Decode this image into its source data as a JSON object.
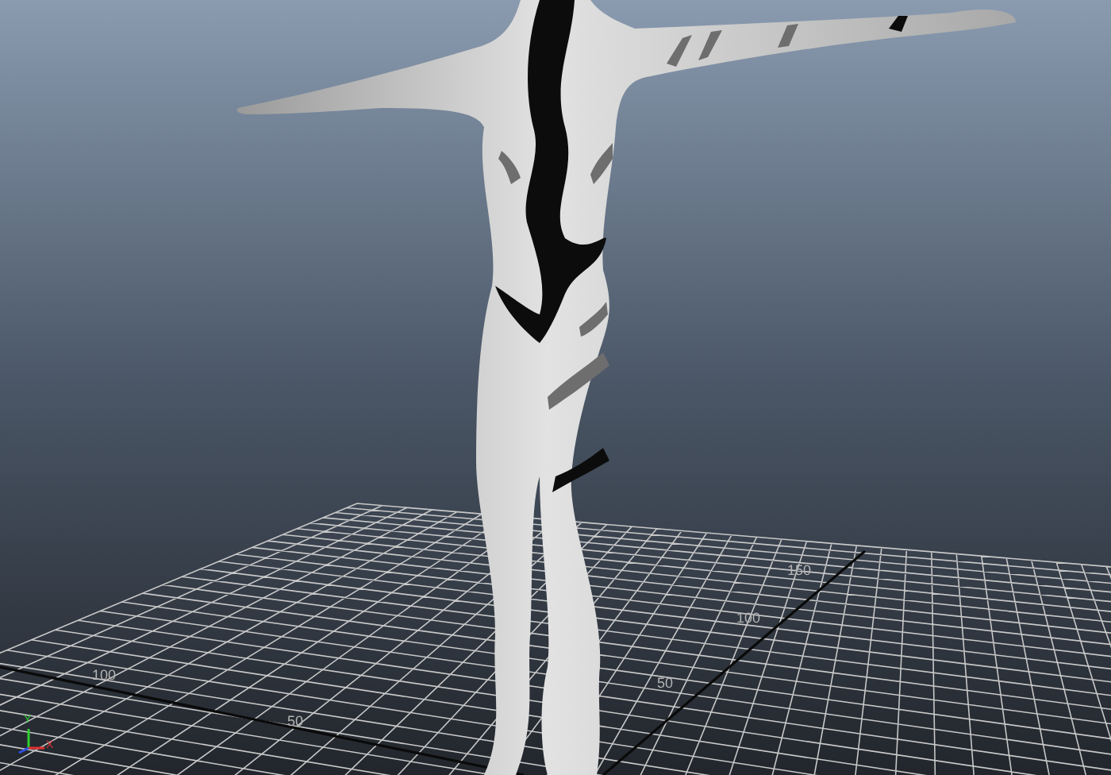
{
  "viewport": {
    "grid_labels": [
      {
        "text": "150"
      },
      {
        "text": "100"
      },
      {
        "text": "100"
      },
      {
        "text": "50"
      },
      {
        "text": "50"
      }
    ],
    "axis_gizmo": [
      {
        "text": "Y",
        "kind": "y"
      },
      {
        "text": "X",
        "kind": "x"
      }
    ]
  }
}
